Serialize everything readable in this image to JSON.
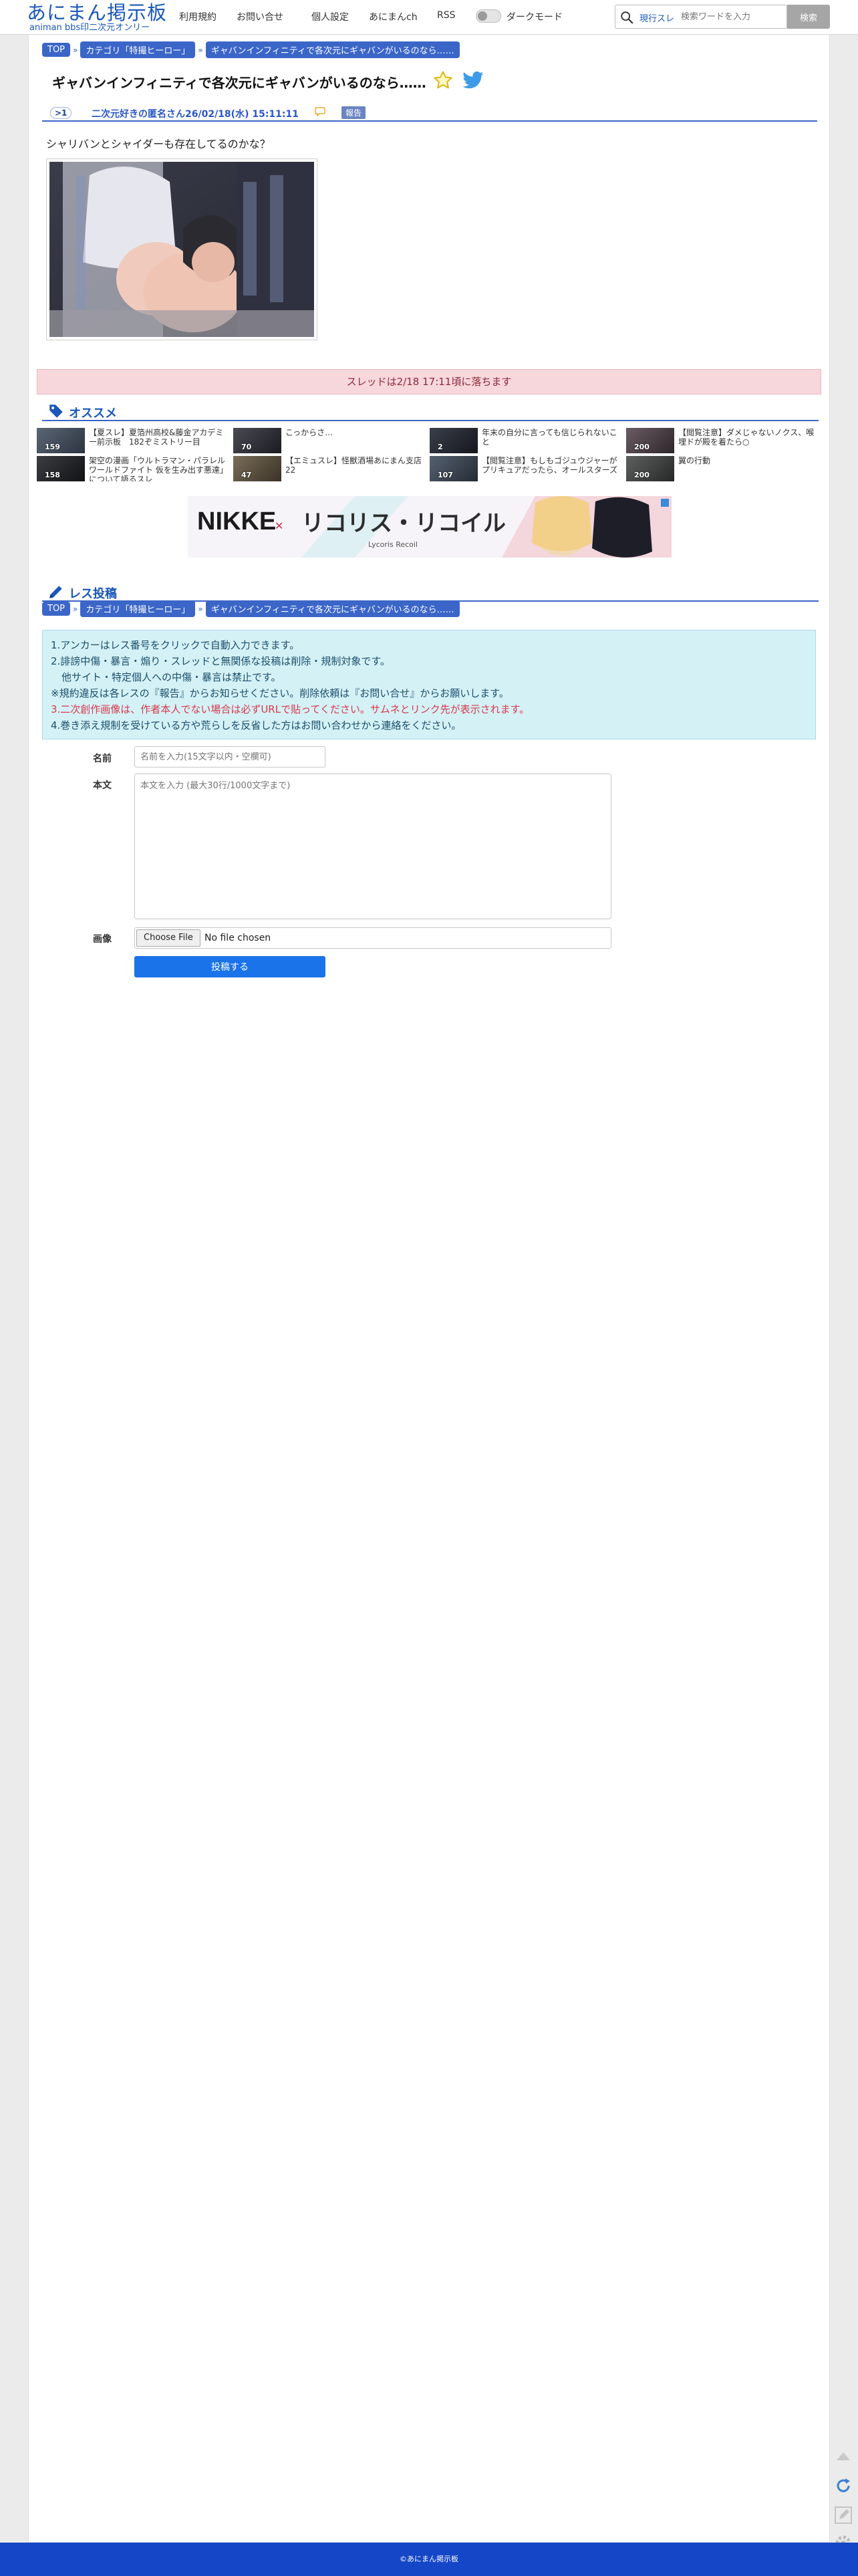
{
  "header": {
    "logo_main": "あにまん掲示板",
    "logo_sub": "animan bbs印二次元オンリー",
    "nav": [
      "利用規約",
      "お問い合せ",
      "個人設定",
      "あにまんch",
      "RSS"
    ],
    "dark_mode_label": "ダークモード",
    "search_mode": "現行スレ",
    "search_placeholder": "検索ワードを入力",
    "search_button": "検索"
  },
  "breadcrumb": {
    "top": "TOP",
    "category": "カテゴリ「特撮ヒーロー」",
    "thread": "ギャバンインフィニティで各次元にギャバンがいるのなら……"
  },
  "thread": {
    "title": "ギャバンインフィニティで各次元にギャバンがいるのなら……",
    "post": {
      "number": ">1",
      "author": "二次元好きの匿名さん",
      "date": "26/02/18(水) 15:11:11",
      "report_label": "報告",
      "body": "シャリバンとシャイダーも存在してるのかな？"
    },
    "expire_notice": "スレッドは2/18 17:11頃に落ちます"
  },
  "recommend": {
    "heading": "オススメ",
    "items": [
      {
        "title": "【夏スレ】夏箔州高校&藤金アカデミー前示板　182ぞミストリー目",
        "count": "159"
      },
      {
        "title": "こっからさ…",
        "count": "70"
      },
      {
        "title": "年末の自分に言っても信じられないこと",
        "count": "2"
      },
      {
        "title": "【閲覧注意】ダメじゃないノクス、喉埋ドが殿を着たら○",
        "count": "200"
      },
      {
        "title": "架空の漫画「ウルトラマン・パラレルワールドファイト 仮を生み出す悪達」について語るスレ",
        "count": "158"
      },
      {
        "title": "【エミュスレ】怪獣酒場あにまん支店22",
        "count": "47"
      },
      {
        "title": "【閲覧注意】もしもゴジュウジャーがプリキュアだったら、オールスターズ",
        "count": "107"
      },
      {
        "title": "翼の行動",
        "count": "200"
      }
    ]
  },
  "ad": {
    "brand_left": "NIKKE",
    "brand_right": "リコリス・リコイル",
    "brand_sub": "Lycoris Recoil"
  },
  "form": {
    "heading": "レス投稿",
    "rules": [
      "1.アンカーはレス番号をクリックで自動入力できます。",
      "2.誹謗中傷・暴言・煽り・スレッドと無関係な投稿は削除・規制対象です。",
      "他サイト・特定個人への中傷・暴言は禁止です。",
      "※規約違反は各レスの『報告』からお知らせください。削除依頼は『お問い合せ』からお願いします。",
      "3.二次創作画像は、作者本人でない場合は必ずURLで貼ってください。サムネとリンク先が表示されます。",
      "4.巻き添え規制を受けている方や荒らしを反省した方はお問い合わせから連絡をください。"
    ],
    "name_label": "名前",
    "name_placeholder": "名前を入力(15文字以内・空欄可)",
    "body_label": "本文",
    "body_placeholder": "本文を入力 (最大30行/1000文字まで)",
    "image_label": "画像",
    "file_button": "Choose File",
    "file_status": "No file chosen",
    "submit": "投稿する"
  },
  "footer": {
    "copyright": "©あにまん掲示板"
  },
  "colors": {
    "brand": "#1a57b9",
    "accent": "#3b66c8",
    "footer": "#1546c7",
    "notice_bg": "#f7d7dc",
    "rules_bg": "#d4f1f6"
  }
}
